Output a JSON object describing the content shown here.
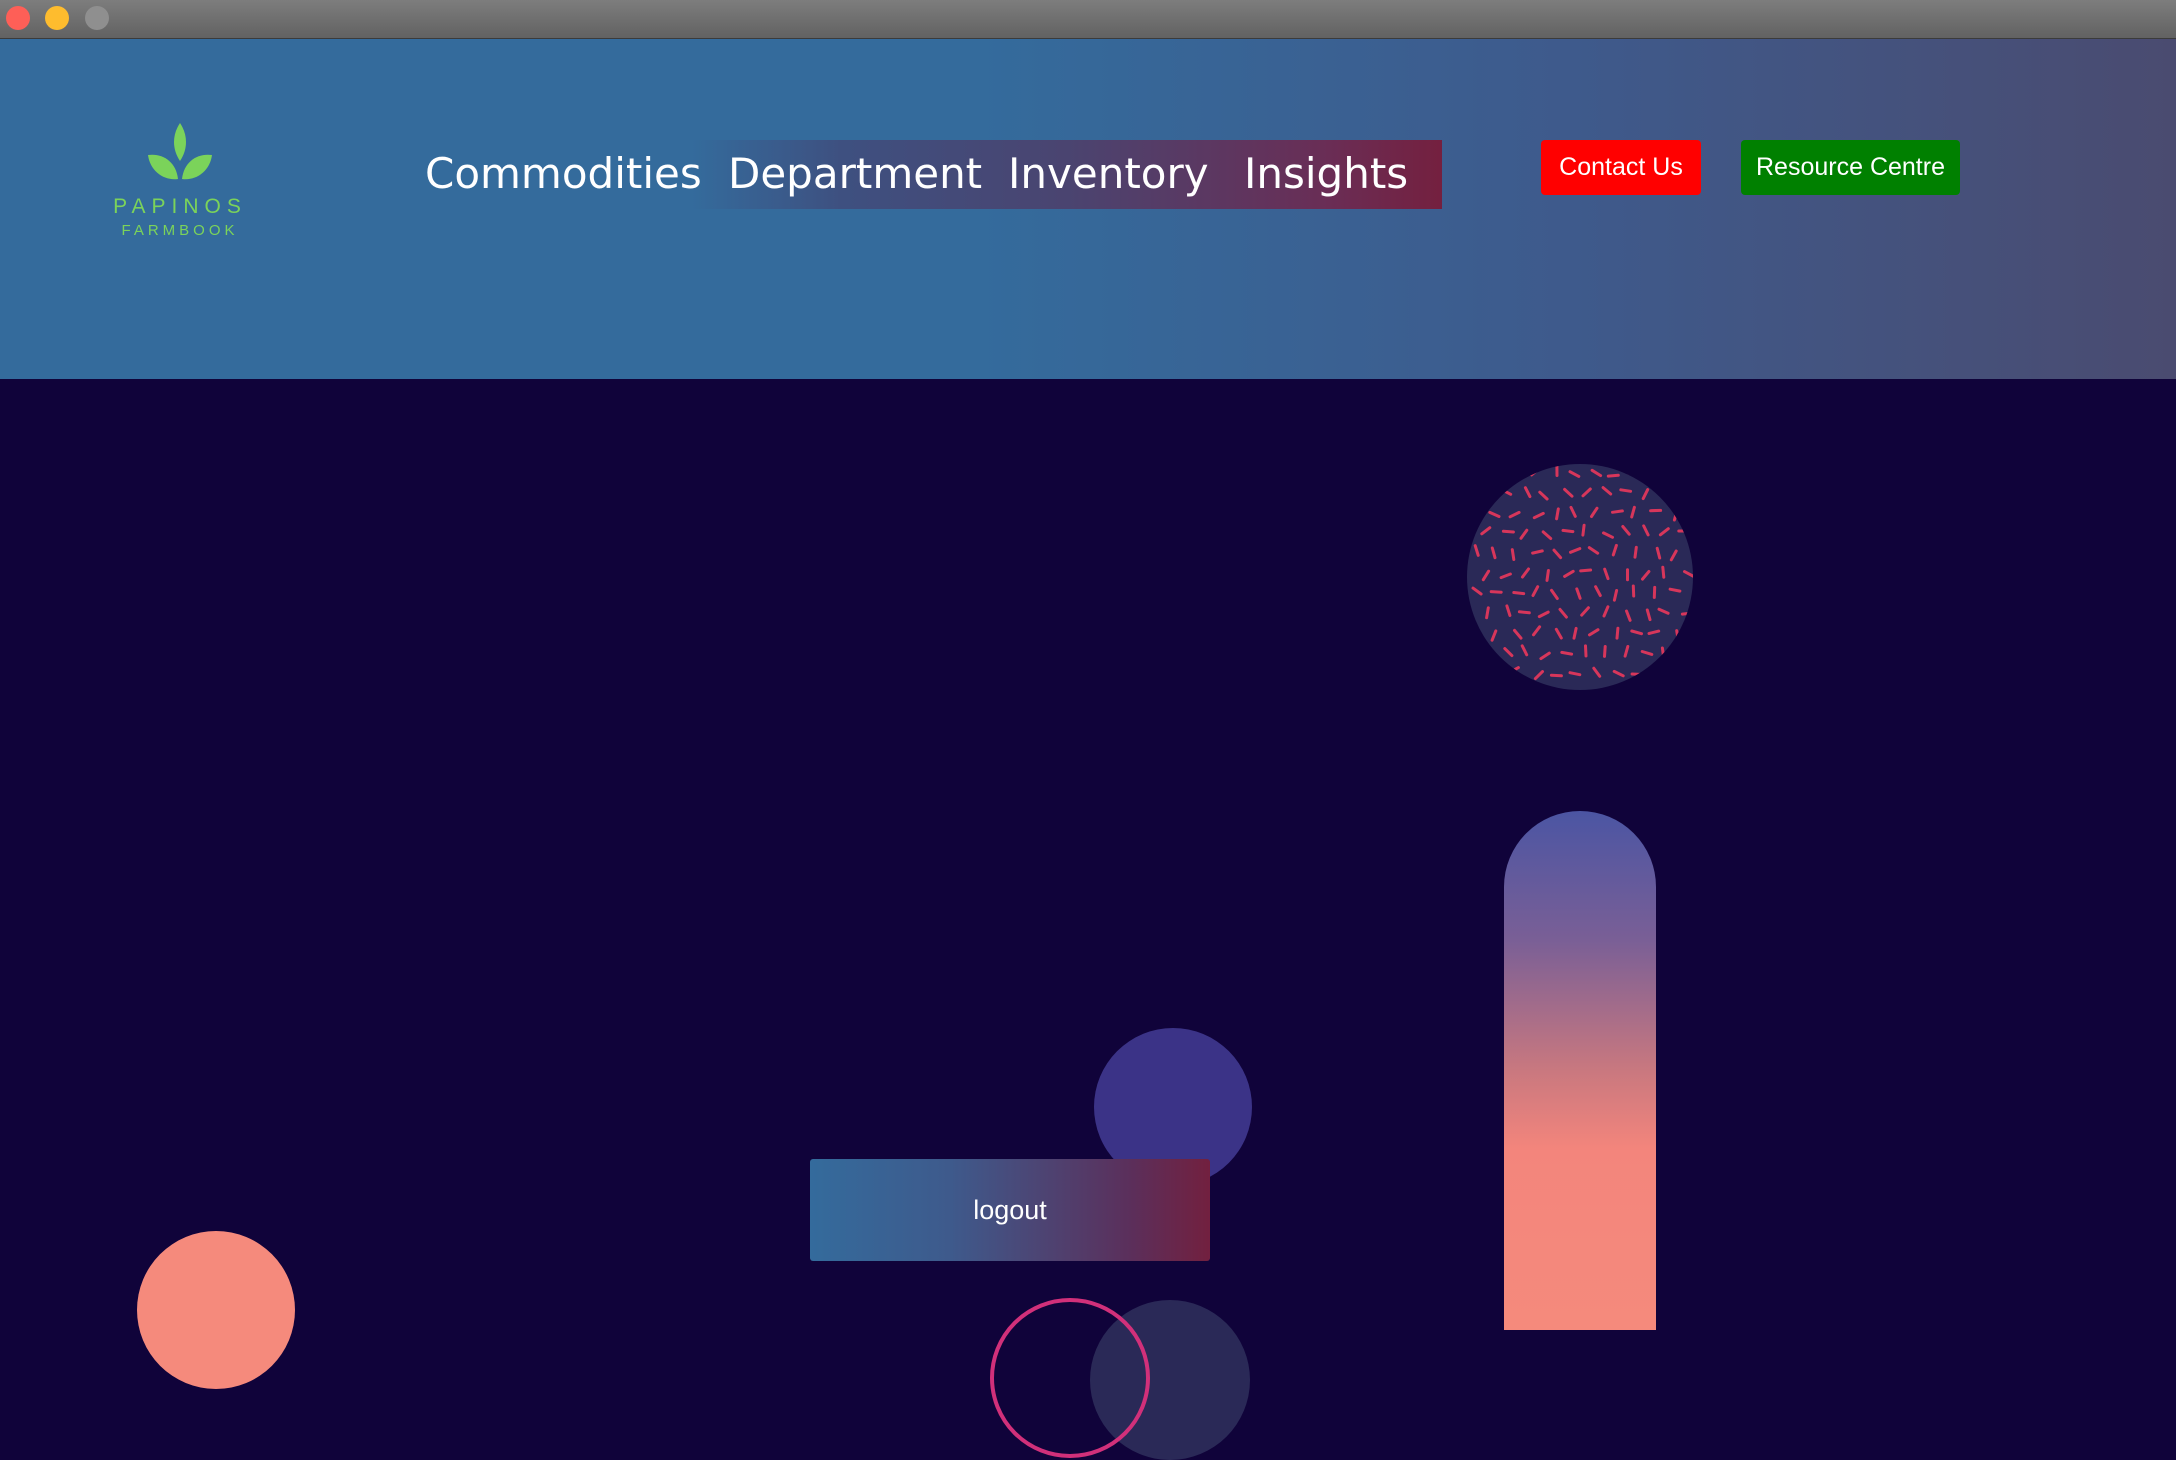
{
  "window": {
    "controls": [
      {
        "name": "close-button",
        "color": "#fe5f57"
      },
      {
        "name": "minimize-button",
        "color": "#febc2e"
      },
      {
        "name": "zoom-button",
        "color": "#8f8f8f"
      }
    ]
  },
  "logo": {
    "title": "PAPINOS",
    "subtitle": "FARMBOOK",
    "icon": "leaf-icon",
    "color": "#7bd35a"
  },
  "nav": {
    "items": [
      {
        "label": "Commodities"
      },
      {
        "label": "Department"
      },
      {
        "label": "Inventory"
      },
      {
        "label": "Insights"
      }
    ]
  },
  "header_buttons": {
    "contact_label": "Contact Us",
    "contact_color": "#ff0000",
    "resource_label": "Resource Centre",
    "resource_color": "#008000"
  },
  "main": {
    "logout_label": "logout",
    "background_color": "#10033a",
    "accent_colors": {
      "pill_top": "#4b55a3",
      "pill_bottom": "#f3857c",
      "coral": "#f58a7c",
      "purple": "#3b3387",
      "pattern_circle": "#2a2957",
      "pattern_dash": "#d7365b",
      "ring": "#d1307a"
    }
  }
}
